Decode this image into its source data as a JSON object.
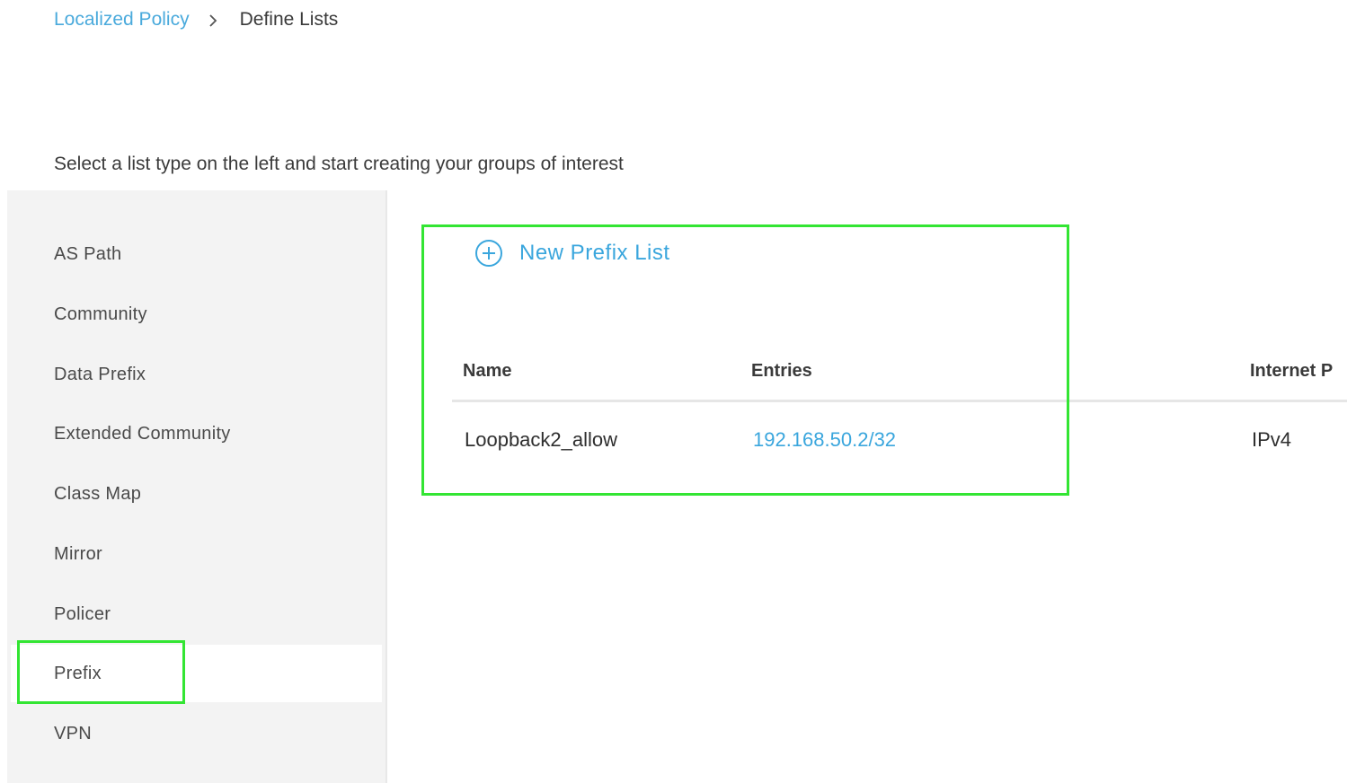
{
  "breadcrumb": {
    "parent": "Localized Policy",
    "current": "Define Lists"
  },
  "intro_text": "Select a list type on the left and start creating your groups of interest",
  "sidebar": {
    "items": [
      {
        "label": "AS Path"
      },
      {
        "label": "Community"
      },
      {
        "label": "Data Prefix"
      },
      {
        "label": "Extended Community"
      },
      {
        "label": "Class Map"
      },
      {
        "label": "Mirror"
      },
      {
        "label": "Policer"
      },
      {
        "label": "Prefix"
      },
      {
        "label": "VPN"
      }
    ],
    "selected": "Prefix"
  },
  "main": {
    "new_button": {
      "label": "New Prefix List",
      "icon": "plus-circle-icon"
    },
    "table": {
      "columns": [
        "Name",
        "Entries",
        "Internet P"
      ],
      "rows": [
        {
          "name": "Loopback2_allow",
          "entries": "192.168.50.2/32",
          "internet_protocol": "IPv4"
        }
      ]
    }
  },
  "colors": {
    "link": "#3aa6dd",
    "highlight": "#33e533",
    "sidebar_bg": "#f3f3f3"
  }
}
